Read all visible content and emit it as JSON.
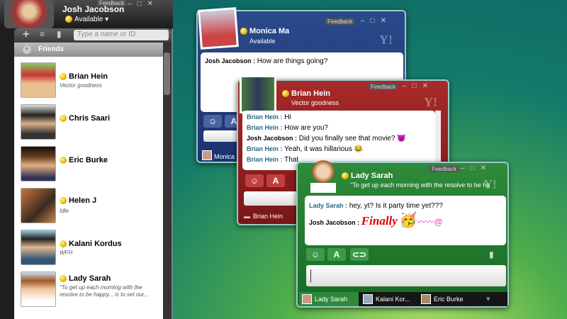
{
  "contact_list": {
    "user_name": "Josh Jacobson",
    "status": "Available",
    "feedback": "Feedback",
    "search_placeholder": "Type a name or ID",
    "group": "Friends",
    "contacts": [
      {
        "name": "Brian Hein",
        "status": "Vector goodness"
      },
      {
        "name": "Chris Saari",
        "status": ""
      },
      {
        "name": "Eric Burke",
        "status": ""
      },
      {
        "name": "Helen J",
        "status": "Idle"
      },
      {
        "name": "Kalani Kordus",
        "status": "WFH"
      },
      {
        "name": "Lady Sarah",
        "status": "\"To get up each morning with the resolve to be happy... is to set our..."
      }
    ]
  },
  "monica_window": {
    "name": "Monica Ma",
    "status": "Available",
    "feedback": "Feedback",
    "tab": "Monica",
    "messages": [
      {
        "from": "Josh Jacobson :",
        "text": "How are things going?"
      }
    ]
  },
  "brian_window": {
    "name": "Brian Hein",
    "status": "Vector goodness",
    "feedback": "Feedback",
    "tab": "Brian Hein",
    "messages": [
      {
        "from": "Brian Hein :",
        "text": "Hi"
      },
      {
        "from": "Brian Hein :",
        "text": "How are you?"
      },
      {
        "from": "Josh Jacobson :",
        "text": "Did you finally see that movie?"
      },
      {
        "from": "Brian Hein :",
        "text": "Yeah, it was hillarious"
      },
      {
        "from": "Brian Hein :",
        "text": "That"
      }
    ]
  },
  "sarah_window": {
    "name": "Lady Sarah",
    "status": "\"To get up each morning with the resolve to be ha",
    "feedback": "Feedback",
    "messages": [
      {
        "from": "Lady Sarah :",
        "text": "hey, yt? Is it party time yet???"
      },
      {
        "from": "Josh Jacobson :",
        "text": "Finally"
      }
    ],
    "tabs": [
      "Lady Sarah",
      "Kalani Kor...",
      "Eric Burke"
    ]
  },
  "toolbar": {
    "font_label": "A",
    "yahoo_logo": "Y!"
  }
}
